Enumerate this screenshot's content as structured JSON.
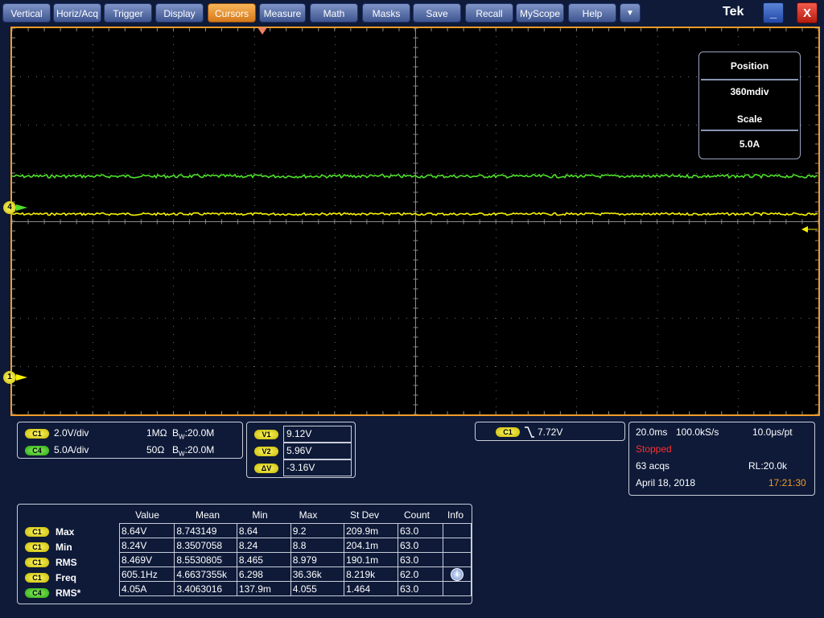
{
  "menu": {
    "items": [
      {
        "label": "Vertical"
      },
      {
        "label": "Horiz/Acq"
      },
      {
        "label": "Trigger"
      },
      {
        "label": "Display"
      },
      {
        "label": "Cursors"
      },
      {
        "label": "Measure"
      },
      {
        "label": "Math"
      },
      {
        "label": "Masks"
      },
      {
        "label": "Save"
      },
      {
        "label": "Recall"
      },
      {
        "label": "MyScope"
      },
      {
        "label": "Help"
      }
    ],
    "active": "Cursors",
    "dropdown_icon": "▼"
  },
  "brand": "Tek",
  "window": {
    "minimize_icon": "_",
    "close_icon": "X"
  },
  "colors": {
    "accent": "#f39b2a",
    "ch1": "#f5f000",
    "ch4": "#4ee02a",
    "stopped": "#ff3030",
    "time": "#f39b2a"
  },
  "position_panel": {
    "position_label": "Position",
    "position_value": "360mdiv",
    "scale_label": "Scale",
    "scale_value": "5.0A"
  },
  "markers": {
    "ch4": "4",
    "ch1": "1"
  },
  "channels": [
    {
      "badge": "C1",
      "scale": "2.0V/div",
      "coupling": "1MΩ",
      "bw_label": "B",
      "bw_sub": "W",
      "bw": ":20.0M"
    },
    {
      "badge": "C4",
      "scale": "5.0A/div",
      "coupling": "50Ω",
      "bw_label": "B",
      "bw_sub": "W",
      "bw": ":20.0M"
    }
  ],
  "cursors": [
    {
      "badge": "V1",
      "value": "9.12V"
    },
    {
      "badge": "V2",
      "value": "5.96V"
    },
    {
      "badge": "ΔV",
      "value": "-3.16V"
    }
  ],
  "trigger": {
    "badge": "C1",
    "value": "7.72V"
  },
  "acquisition": {
    "time_div": "20.0ms",
    "sample_rate": "100.0kS/s",
    "per_point": "10.0μs/pt",
    "status": "Stopped",
    "acqs": "63 acqs",
    "record_length": "RL:20.0k",
    "date": "April 18, 2018",
    "time": "17:21:30"
  },
  "measurements": {
    "headers": [
      "Value",
      "Mean",
      "Min",
      "Max",
      "St Dev",
      "Count",
      "Info"
    ],
    "rows": [
      {
        "badge": "C1",
        "name": "Max",
        "values": [
          "8.64V",
          "8.743149",
          "8.64",
          "9.2",
          "209.9m",
          "63.0"
        ],
        "info": ""
      },
      {
        "badge": "C1",
        "name": "Min",
        "values": [
          "8.24V",
          "8.3507058",
          "8.24",
          "8.8",
          "204.1m",
          "63.0"
        ],
        "info": ""
      },
      {
        "badge": "C1",
        "name": "RMS",
        "values": [
          "8.469V",
          "8.5530805",
          "8.465",
          "8.979",
          "190.1m",
          "63.0"
        ],
        "info": ""
      },
      {
        "badge": "C1",
        "name": "Freq",
        "values": [
          "605.1Hz",
          "4.6637355k",
          "6.298",
          "36.36k",
          "8.219k",
          "62.0"
        ],
        "info": "info-icon"
      },
      {
        "badge": "C4",
        "name": "RMS*",
        "values": [
          "4.05A",
          "3.4063016",
          "137.9m",
          "4.055",
          "1.464",
          "63.0"
        ],
        "info": ""
      }
    ]
  }
}
